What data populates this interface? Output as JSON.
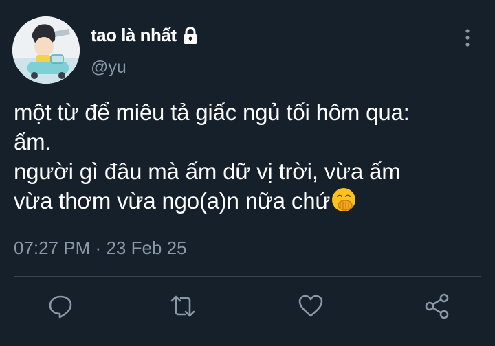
{
  "user": {
    "display_name": "tao là nhất",
    "handle": "@yu",
    "avatar_icon": "cartoon-child-avatar",
    "locked_icon": "lock-icon"
  },
  "tweet": {
    "lines": [
      "một từ để miêu tả giấc ngủ tối hôm qua:",
      "ấm.",
      "người gì đâu mà ấm dữ vị trời, vừa ấm",
      "vừa thơm vừa ngo(a)n nữa chứ"
    ],
    "emoji": "face-with-hand-over-mouth"
  },
  "meta": {
    "time": "07:27 PM",
    "separator": "·",
    "date": "23 Feb 25"
  },
  "actions": {
    "reply_icon": "reply-icon",
    "retweet_icon": "retweet-icon",
    "like_icon": "heart-icon",
    "share_icon": "share-icon"
  },
  "colors": {
    "background": "#15202b",
    "text": "#ffffff",
    "secondary": "#8b98a5",
    "divider": "#38444d"
  }
}
